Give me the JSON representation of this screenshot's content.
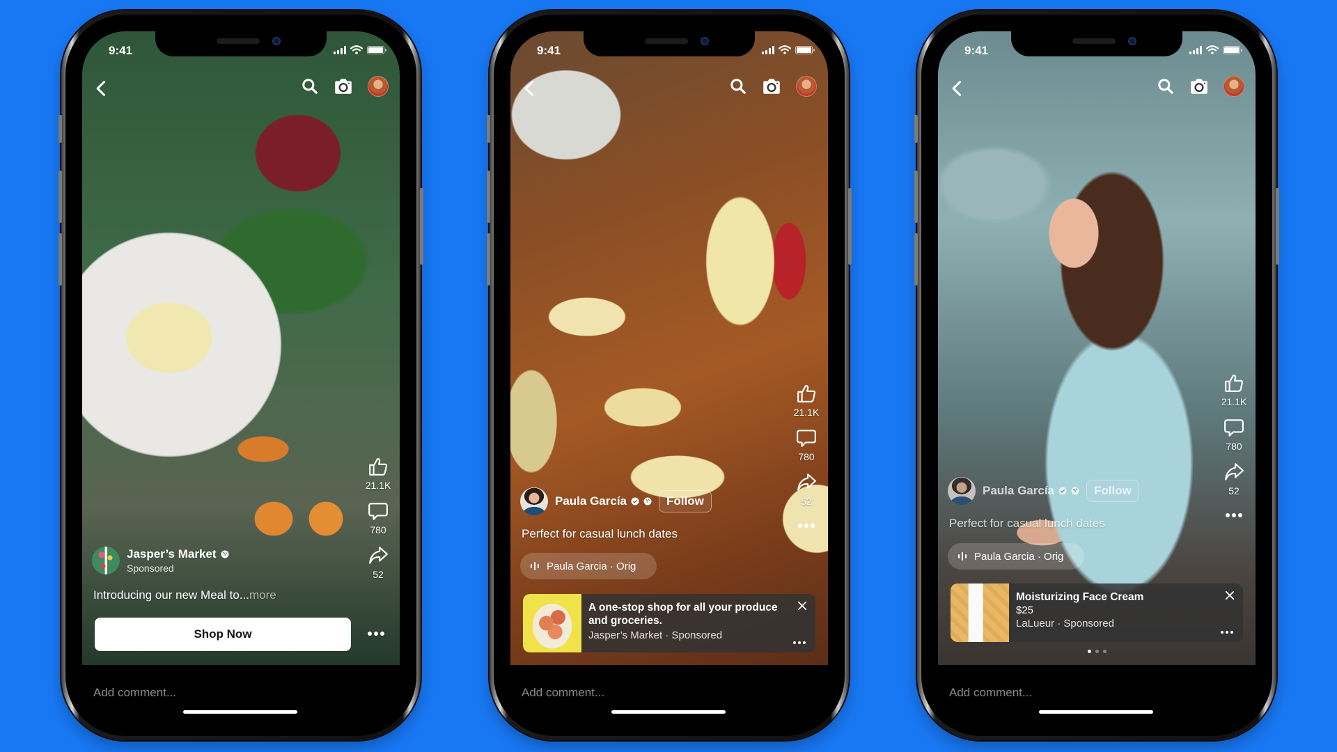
{
  "background_color": "#1877f2",
  "phones": [
    {
      "status": {
        "time": "9:41"
      },
      "topbar": {
        "back_icon": "chevron-left-icon",
        "search_icon": "search-icon",
        "camera_icon": "camera-icon",
        "profile_icon": "profile-avatar"
      },
      "actions": [
        {
          "icon": "thumbs-up-icon",
          "count": "21.1K"
        },
        {
          "icon": "comment-bubble-icon",
          "count": "780"
        },
        {
          "icon": "share-arrow-icon",
          "count": "52"
        }
      ],
      "creator": {
        "name": "Jasper’s Market",
        "badge": "globe-icon",
        "subtitle": "Sponsored"
      },
      "caption": {
        "text": "Introducing our new Meal to...",
        "more": "more"
      },
      "cta": {
        "label": "Shop Now"
      },
      "progress_fraction": 0.33,
      "comment_placeholder": "Add comment..."
    },
    {
      "status": {
        "time": "9:41"
      },
      "topbar": {
        "back_icon": "chevron-left-icon",
        "search_icon": "search-icon",
        "camera_icon": "camera-icon",
        "profile_icon": "profile-avatar"
      },
      "actions": [
        {
          "icon": "thumbs-up-icon",
          "count": "21.1K"
        },
        {
          "icon": "comment-bubble-icon",
          "count": "780"
        },
        {
          "icon": "share-arrow-icon",
          "count": "52"
        }
      ],
      "creator": {
        "name": "Paula García",
        "follow_label": "Follow"
      },
      "caption": {
        "text": "Perfect for casual lunch dates"
      },
      "audio": {
        "text": "Paula Garcia · Orig"
      },
      "ad": {
        "title": "A one-stop shop for all your produce and groceries.",
        "meta": "Jasper’s Market · Sponsored"
      },
      "comment_placeholder": "Add comment..."
    },
    {
      "status": {
        "time": "9:41"
      },
      "topbar": {
        "back_icon": "chevron-left-icon",
        "search_icon": "search-icon",
        "camera_icon": "camera-icon",
        "profile_icon": "profile-avatar"
      },
      "actions": [
        {
          "icon": "thumbs-up-icon",
          "count": "21.1K"
        },
        {
          "icon": "comment-bubble-icon",
          "count": "780"
        },
        {
          "icon": "share-arrow-icon",
          "count": "52"
        }
      ],
      "creator": {
        "name": "Paula García",
        "follow_label": "Follow"
      },
      "caption": {
        "text": "Perfect for casual lunch dates"
      },
      "audio": {
        "text": "Paula Garcia · Orig"
      },
      "ad": {
        "title": "Moisturizing Face Cream",
        "price": "$25",
        "meta": "LaLueur · Sponsored"
      },
      "carousel": {
        "pages": 3,
        "active": 1
      },
      "comment_placeholder": "Add comment..."
    }
  ]
}
